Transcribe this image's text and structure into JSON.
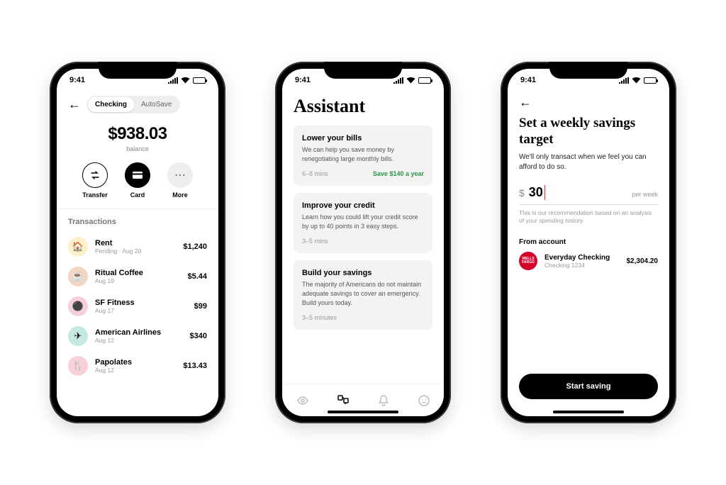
{
  "status": {
    "time": "9:41"
  },
  "phone1": {
    "tabs": {
      "checking": "Checking",
      "autosave": "AutoSave"
    },
    "balance": {
      "amount": "$938.03",
      "label": "balance"
    },
    "actions": {
      "transfer": "Transfer",
      "card": "Card",
      "more": "More"
    },
    "transactions_title": "Transactions",
    "transactions": [
      {
        "name": "Rent",
        "sub": "Pending · Aug 20",
        "amount": "$1,240",
        "color": "#fff0c9",
        "icon": "🏠"
      },
      {
        "name": "Ritual Coffee",
        "sub": "Aug 19",
        "amount": "$5.44",
        "color": "#f1d6c4",
        "icon": "☕"
      },
      {
        "name": "SF Fitness",
        "sub": "Aug 17",
        "amount": "$99",
        "color": "#f5cfe0",
        "icon": "⚫"
      },
      {
        "name": "American Airlines",
        "sub": "Aug 12",
        "amount": "$340",
        "color": "#c5e8e2",
        "icon": "✈︎"
      },
      {
        "name": "Papolates",
        "sub": "Aug 12",
        "amount": "$13.43",
        "color": "#f7d1d7",
        "icon": "🍴"
      }
    ]
  },
  "phone2": {
    "title": "Assistant",
    "cards": [
      {
        "title": "Lower your bills",
        "desc": "We can help you save money by renegotiating large monthly bills.",
        "time": "6–8 mins",
        "save": "Save $140 a year"
      },
      {
        "title": "Improve your credit",
        "desc": "Learn how you could lift your credit score by up to 40 points in 3 easy steps.",
        "time": "3–5 mins",
        "save": ""
      },
      {
        "title": "Build your savings",
        "desc": "The majority of Americans do not maintain adequate savings to cover an emergency. Build yours today.",
        "time": "3–5 minutes",
        "save": ""
      }
    ]
  },
  "phone3": {
    "title": "Set a weekly savings target",
    "subtitle": "We'll only transact when we feel you can afford to do so.",
    "currency": "$",
    "amount": "30",
    "period": "per week",
    "hint": "This is our recommendation based on an analysis of your spending history.",
    "from_label": "From account",
    "account": {
      "bank": "WELLS FARGO",
      "name": "Everyday Checking",
      "sub": "Checking 1234",
      "balance": "$2,304.20"
    },
    "cta": "Start saving"
  }
}
